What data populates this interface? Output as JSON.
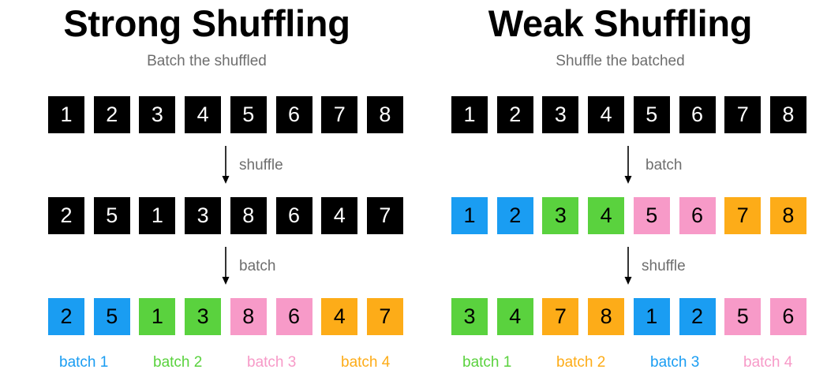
{
  "colors": {
    "black": "#000000",
    "blue": "#1a9df2",
    "green": "#5ad23e",
    "pink": "#f79ac8",
    "orange": "#fdac18",
    "label_gray": "#6e6e6e"
  },
  "strong": {
    "title": "Strong Shuffling",
    "subtitle": "Batch the shuffled",
    "row1": [
      {
        "value": "1",
        "color": "black"
      },
      {
        "value": "2",
        "color": "black"
      },
      {
        "value": "3",
        "color": "black"
      },
      {
        "value": "4",
        "color": "black"
      },
      {
        "value": "5",
        "color": "black"
      },
      {
        "value": "6",
        "color": "black"
      },
      {
        "value": "7",
        "color": "black"
      },
      {
        "value": "8",
        "color": "black"
      }
    ],
    "step1": "shuffle",
    "row2": [
      {
        "value": "2",
        "color": "black"
      },
      {
        "value": "5",
        "color": "black"
      },
      {
        "value": "1",
        "color": "black"
      },
      {
        "value": "3",
        "color": "black"
      },
      {
        "value": "8",
        "color": "black"
      },
      {
        "value": "6",
        "color": "black"
      },
      {
        "value": "4",
        "color": "black"
      },
      {
        "value": "7",
        "color": "black"
      }
    ],
    "step2": "batch",
    "row3": [
      {
        "value": "2",
        "color": "blue"
      },
      {
        "value": "5",
        "color": "blue"
      },
      {
        "value": "1",
        "color": "green"
      },
      {
        "value": "3",
        "color": "green"
      },
      {
        "value": "8",
        "color": "pink"
      },
      {
        "value": "6",
        "color": "pink"
      },
      {
        "value": "4",
        "color": "orange"
      },
      {
        "value": "7",
        "color": "orange"
      }
    ],
    "legend": [
      {
        "label": "batch 1",
        "color": "blue"
      },
      {
        "label": "batch 2",
        "color": "green"
      },
      {
        "label": "batch 3",
        "color": "pink"
      },
      {
        "label": "batch 4",
        "color": "orange"
      }
    ]
  },
  "weak": {
    "title": "Weak Shuffling",
    "subtitle": "Shuffle the batched",
    "row1": [
      {
        "value": "1",
        "color": "black"
      },
      {
        "value": "2",
        "color": "black"
      },
      {
        "value": "3",
        "color": "black"
      },
      {
        "value": "4",
        "color": "black"
      },
      {
        "value": "5",
        "color": "black"
      },
      {
        "value": "6",
        "color": "black"
      },
      {
        "value": "7",
        "color": "black"
      },
      {
        "value": "8",
        "color": "black"
      }
    ],
    "step1": "batch",
    "row2": [
      {
        "value": "1",
        "color": "blue"
      },
      {
        "value": "2",
        "color": "blue"
      },
      {
        "value": "3",
        "color": "green"
      },
      {
        "value": "4",
        "color": "green"
      },
      {
        "value": "5",
        "color": "pink"
      },
      {
        "value": "6",
        "color": "pink"
      },
      {
        "value": "7",
        "color": "orange"
      },
      {
        "value": "8",
        "color": "orange"
      }
    ],
    "step2": "shuffle",
    "row3": [
      {
        "value": "3",
        "color": "green"
      },
      {
        "value": "4",
        "color": "green"
      },
      {
        "value": "7",
        "color": "orange"
      },
      {
        "value": "8",
        "color": "orange"
      },
      {
        "value": "1",
        "color": "blue"
      },
      {
        "value": "2",
        "color": "blue"
      },
      {
        "value": "5",
        "color": "pink"
      },
      {
        "value": "6",
        "color": "pink"
      }
    ],
    "legend": [
      {
        "label": "batch 1",
        "color": "green"
      },
      {
        "label": "batch 2",
        "color": "orange"
      },
      {
        "label": "batch 3",
        "color": "blue"
      },
      {
        "label": "batch 4",
        "color": "pink"
      }
    ]
  }
}
